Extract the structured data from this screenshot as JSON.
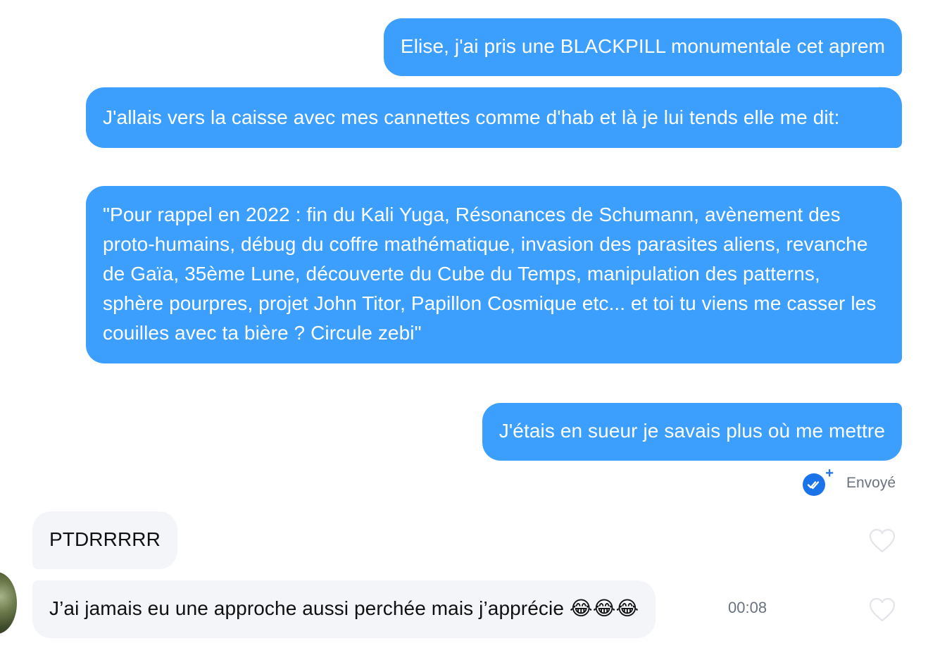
{
  "messages": [
    {
      "text": "Elise, j'ai pris une BLACKPILL monumentale cet aprem"
    },
    {
      "text": "J'allais vers la caisse avec mes cannettes comme d'hab et là je lui tends elle me dit:"
    },
    {
      "text": "\"Pour rappel en 2022 : fin du Kali Yuga, Résonances de Schumann, avènement des proto-humains, débug du coffre mathématique, invasion des parasites aliens, revanche de Gaïa, 35ème Lune, découverte du Cube du Temps, manipulation des patterns, sphère pourpres, projet John Titor, Papillon Cosmique etc... et toi tu viens me casser les couilles avec ta bière ? Circule zebi\""
    },
    {
      "text": "J'étais en sueur je savais plus où me mettre"
    },
    {
      "text": "PTDRRRRR"
    },
    {
      "text": "J’ai jamais eu une approche aussi perchée mais j’apprécie",
      "emoji": "😂😂😂"
    }
  ],
  "status": {
    "label": "Envoyé",
    "icon": "double-check-plus-icon"
  },
  "timestamp": "00:08",
  "colors": {
    "sent_bubble": "#3c9ffe",
    "received_bubble": "#f4f5f9",
    "status_blue": "#1a73e8"
  }
}
